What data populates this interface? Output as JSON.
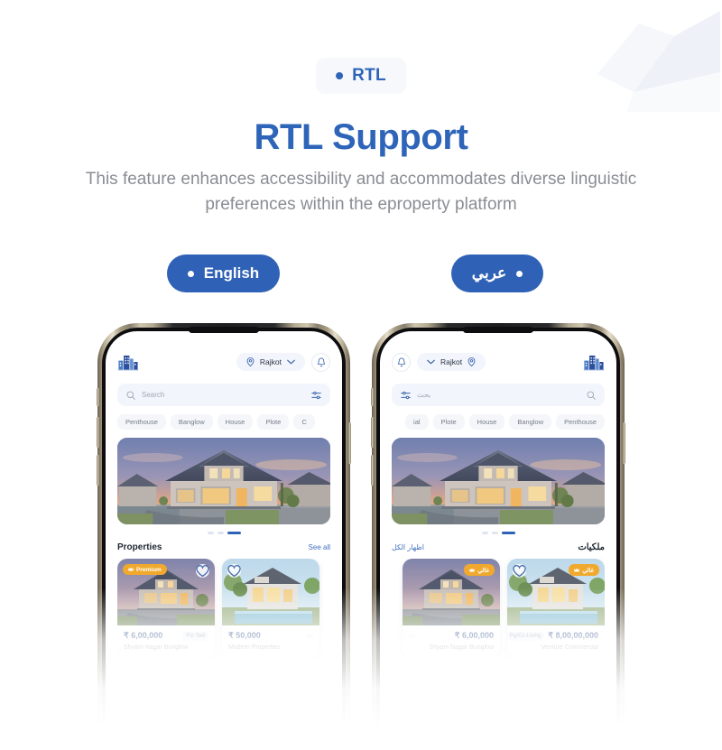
{
  "header": {
    "badge_label": "RTL",
    "title": "RTL Support",
    "subtitle": "This feature enhances accessibility and accommodates diverse linguistic preferences within the eproperty platform"
  },
  "colors": {
    "brand_blue": "#2e65b8",
    "button_blue": "#2f62b6",
    "badge_bg": "#f6f8fc",
    "subtitle_gray": "#8a8d93",
    "premium_gold": "#f0a92c",
    "price_blue": "#2b4a86"
  },
  "language_buttons": [
    {
      "label": "English",
      "dot": "left"
    },
    {
      "label": "عربي",
      "dot": "right"
    }
  ],
  "phones": {
    "english": {
      "direction": "ltr",
      "logo_icon": "buildings-logo-icon",
      "location": {
        "label": "Rajkot",
        "pin_icon": "map-pin-icon",
        "chevron_icon": "chevron-down-icon"
      },
      "notification_icon": "bell-icon",
      "search": {
        "placeholder": "Search",
        "search_icon": "search-icon",
        "filter_icon": "filter-sliders-icon"
      },
      "chips": [
        "Penthouse",
        "Banglow",
        "House",
        "Plote",
        "C"
      ],
      "carousel_dots": {
        "count": 3,
        "active_index": 2
      },
      "section": {
        "title": "Properties",
        "link": "See all"
      },
      "cards": [
        {
          "badge": "Premium",
          "badge_icon": "crown-icon",
          "favorite_icon": "heart-icon",
          "price": "₹ 6,00,000",
          "tag": "For Sell",
          "name": "Shyam Nagar Bunglow"
        },
        {
          "badge": null,
          "favorite_icon": "heart-icon",
          "price": "₹ 50,000",
          "tag": "",
          "name": "Modern Properties"
        }
      ]
    },
    "arabic": {
      "direction": "rtl",
      "logo_icon": "buildings-logo-icon",
      "location": {
        "label": "Rajkot",
        "pin_icon": "map-pin-icon",
        "chevron_icon": "chevron-down-icon"
      },
      "notification_icon": "bell-icon",
      "search": {
        "placeholder": "بحث",
        "search_icon": "search-icon",
        "filter_icon": "filter-sliders-icon"
      },
      "chips": [
        "Penthouse",
        "Banglow",
        "House",
        "Plote",
        "ial"
      ],
      "carousel_dots": {
        "count": 3,
        "active_index": 0
      },
      "section": {
        "title": "ملكيات",
        "link": "اظهار الكل"
      },
      "cards": [
        {
          "badge": "غالي",
          "badge_icon": "crown-icon",
          "favorite_icon": "heart-icon",
          "price": "8,00,00,000 ₹",
          "tag": "Pg/Co-Living",
          "name": "Venture Commercial"
        },
        {
          "badge": "غالي",
          "badge_icon": "crown-icon",
          "favorite_icon": "heart-icon",
          "price": "6,00,000 ₹",
          "tag": "",
          "name": "Shyam Nagar Bunglow"
        }
      ]
    }
  },
  "decor": {
    "cube_icon": "3d-cube-decoration"
  }
}
